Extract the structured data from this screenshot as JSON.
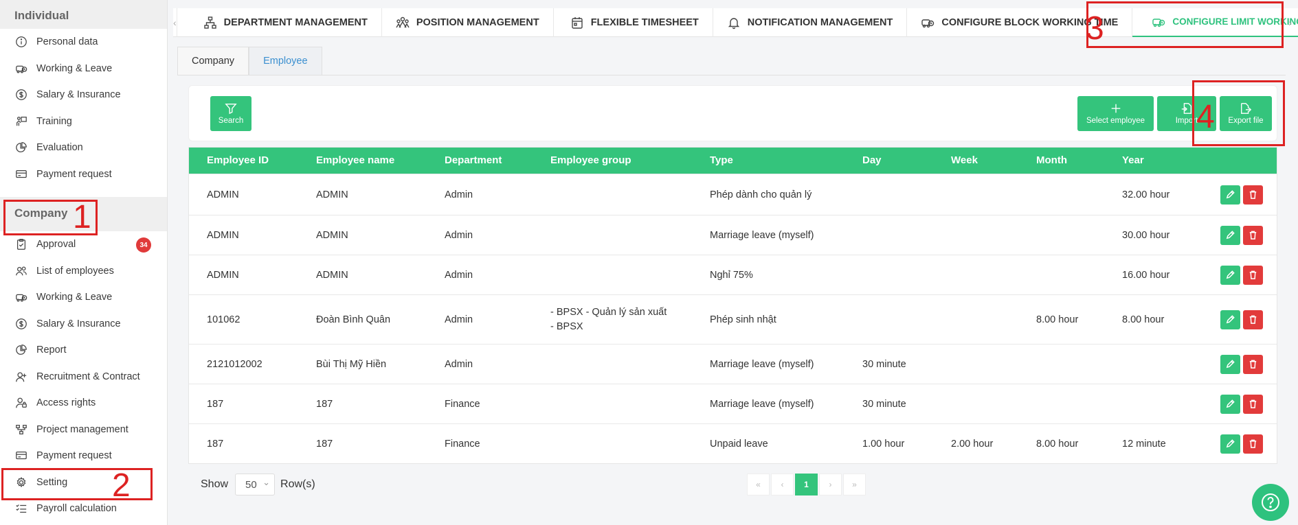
{
  "sidebar": {
    "individual_title": "Individual",
    "individual_items": [
      {
        "label": "Personal data",
        "icon": "info-icon"
      },
      {
        "label": "Working & Leave",
        "icon": "car-clock-icon"
      },
      {
        "label": "Salary & Insurance",
        "icon": "dollar-icon"
      },
      {
        "label": "Training",
        "icon": "training-icon"
      },
      {
        "label": "Evaluation",
        "icon": "pie-icon"
      },
      {
        "label": "Payment request",
        "icon": "card-icon"
      }
    ],
    "company_title": "Company",
    "company_items": [
      {
        "label": "Approval",
        "icon": "clipboard-icon",
        "badge": "34"
      },
      {
        "label": "List of employees",
        "icon": "users-icon"
      },
      {
        "label": "Working & Leave",
        "icon": "car-clock-icon"
      },
      {
        "label": "Salary & Insurance",
        "icon": "dollar-icon"
      },
      {
        "label": "Report",
        "icon": "pie-icon"
      },
      {
        "label": "Recruitment & Contract",
        "icon": "user-plus-icon"
      },
      {
        "label": "Access rights",
        "icon": "user-lock-icon"
      },
      {
        "label": "Project management",
        "icon": "project-icon"
      },
      {
        "label": "Payment request",
        "icon": "card-icon"
      },
      {
        "label": "Setting",
        "icon": "gear-icon"
      },
      {
        "label": "Payroll calculation",
        "icon": "list-icon"
      }
    ]
  },
  "tabs": [
    {
      "label": "DEPARTMENT MANAGEMENT",
      "icon": "org-icon"
    },
    {
      "label": "POSITION MANAGEMENT",
      "icon": "group-icon"
    },
    {
      "label": "FLEXIBLE TIMESHEET",
      "icon": "calendar-icon"
    },
    {
      "label": "NOTIFICATION MANAGEMENT",
      "icon": "bell-icon"
    },
    {
      "label": "CONFIGURE BLOCK WORKING TIME",
      "icon": "car-clock-icon"
    },
    {
      "label": "CONFIGURE LIMIT WORKING TIME",
      "icon": "car-clock-icon"
    }
  ],
  "subtabs": {
    "company": "Company",
    "employee": "Employee"
  },
  "toolbar": {
    "search": "Search",
    "select_employee": "Select employee",
    "import": "Import",
    "export": "Export file"
  },
  "table": {
    "headers": [
      "Employee ID",
      "Employee name",
      "Department",
      "Employee group",
      "Type",
      "Day",
      "Week",
      "Month",
      "Year"
    ],
    "rows": [
      {
        "id": "ADMIN",
        "name": "ADMIN",
        "dept": "Admin",
        "group": [
          "",
          ""
        ],
        "type": "Phép dành cho quản lý",
        "day": "",
        "week": "",
        "month": "",
        "year": "32.00 hour"
      },
      {
        "id": "ADMIN",
        "name": "ADMIN",
        "dept": "Admin",
        "group": [
          "",
          ""
        ],
        "type": "Marriage leave (myself)",
        "day": "",
        "week": "",
        "month": "",
        "year": "30.00 hour"
      },
      {
        "id": "ADMIN",
        "name": "ADMIN",
        "dept": "Admin",
        "group": [
          "",
          ""
        ],
        "type": "Nghỉ 75%",
        "day": "",
        "week": "",
        "month": "",
        "year": "16.00 hour"
      },
      {
        "id": "101062",
        "name": "Đoàn Bình Quân",
        "dept": "Admin",
        "group": [
          "- BPSX - Quản lý sản xuất",
          "- BPSX"
        ],
        "type": "Phép sinh nhật",
        "day": "",
        "week": "",
        "month": "8.00 hour",
        "year": "8.00 hour"
      },
      {
        "id": "2121012002",
        "name": "Bùi Thị Mỹ Hiền",
        "dept": "Admin",
        "group": [
          "",
          ""
        ],
        "type": "Marriage leave (myself)",
        "day": "30 minute",
        "week": "",
        "month": "",
        "year": ""
      },
      {
        "id": "187",
        "name": "187",
        "dept": "Finance",
        "group": [
          "",
          ""
        ],
        "type": "Marriage leave (myself)",
        "day": "30 minute",
        "week": "",
        "month": "",
        "year": ""
      },
      {
        "id": "187",
        "name": "187",
        "dept": "Finance",
        "group": [
          "",
          ""
        ],
        "type": "Unpaid leave",
        "day": "1.00 hour",
        "week": "2.00 hour",
        "month": "8.00 hour",
        "year": "12 minute"
      }
    ]
  },
  "pagination": {
    "show": "Show",
    "rows_value": "50",
    "rows_label": "Row(s)",
    "first": "«",
    "prev": "‹",
    "current": "1",
    "next": "›",
    "last": "»"
  },
  "annotations": [
    "1",
    "2",
    "3",
    "4"
  ],
  "colors": {
    "accent": "#34c47c",
    "danger": "#e23b3b",
    "annotation": "#dd2222"
  }
}
